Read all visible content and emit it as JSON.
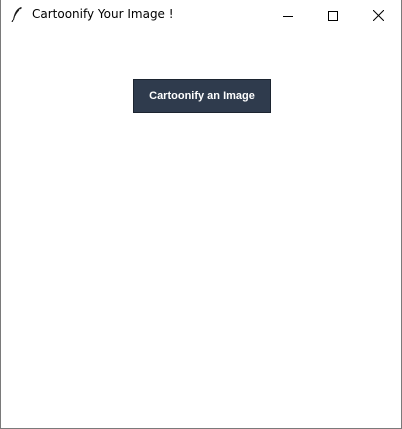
{
  "window": {
    "title": "Cartoonify Your Image !",
    "app_icon": "feather-icon",
    "controls": [
      "minimize-icon",
      "maximize-icon",
      "close-icon"
    ]
  },
  "main": {
    "button_label": "Cartoonify an Image",
    "button_color": "#2f3b4d",
    "button_text_color": "#ffffff",
    "background_color": "#ffffff"
  }
}
